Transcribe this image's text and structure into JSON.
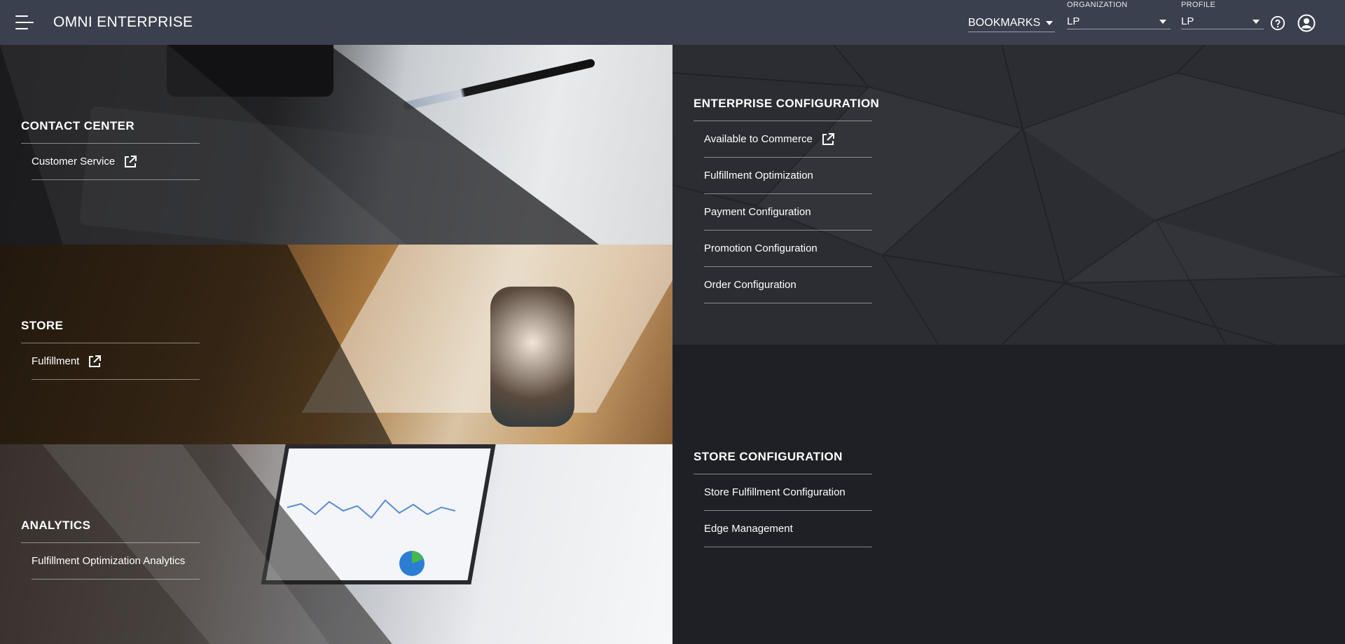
{
  "header": {
    "app_title": "OMNI ENTERPRISE",
    "bookmarks_label": "BOOKMARKS",
    "organization": {
      "label": "ORGANIZATION",
      "value": "LP"
    },
    "profile": {
      "label": "PROFILE",
      "value": "LP"
    }
  },
  "tiles": {
    "contact_center": {
      "title": "CONTACT CENTER",
      "links": [
        "Customer Service"
      ]
    },
    "store": {
      "title": "STORE",
      "links": [
        "Fulfillment"
      ]
    },
    "analytics": {
      "title": "ANALYTICS",
      "links": [
        "Fulfillment Optimization Analytics"
      ]
    }
  },
  "panels": {
    "enterprise_configuration": {
      "title": "ENTERPRISE CONFIGURATION",
      "links": [
        "Available to Commerce",
        "Fulfillment Optimization",
        "Payment Configuration",
        "Promotion Configuration",
        "Order Configuration"
      ]
    },
    "store_configuration": {
      "title": "STORE CONFIGURATION",
      "links": [
        "Store Fulfillment Configuration",
        "Edge Management"
      ]
    }
  },
  "icons": {
    "menu": "hamburger-icon",
    "help": "help-circle-icon",
    "user": "user-circle-icon",
    "external": "external-link-icon"
  },
  "colors": {
    "header_bg": "#3b404e",
    "page_bg": "#1f2026",
    "enterprise_panel_bg": "#2c2d33"
  }
}
